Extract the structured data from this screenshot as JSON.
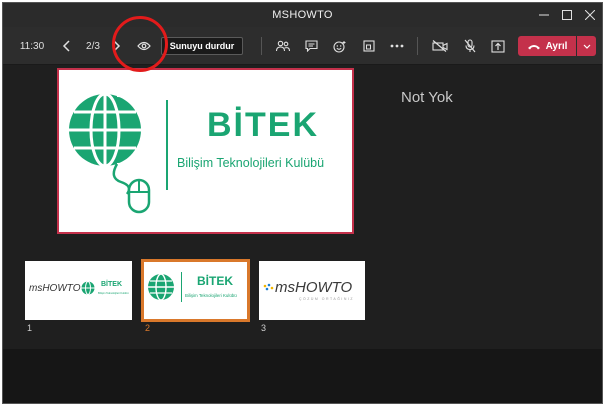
{
  "window": {
    "title": "MSHOWTO"
  },
  "toolbar": {
    "time": "11:30",
    "page_indicator": "2/3",
    "stop_presenting_label": "Sunuyu durdur",
    "leave_label": "Ayrıl"
  },
  "main_slide": {
    "brand": "BİTEK",
    "subtitle": "Bilişim Teknolojileri Kulübü"
  },
  "notes": {
    "text": "Not Yok"
  },
  "thumbnails": [
    {
      "number": "1",
      "label": "msHOWTO",
      "brand": "BİTEK",
      "subtitle": "Bilişim Teknolojileri Kulübü"
    },
    {
      "number": "2",
      "brand": "BİTEK",
      "subtitle": "Bilişim Teknolojileri Kulübü"
    },
    {
      "number": "3",
      "label": "msHOWTO",
      "tagline": "ÇÖZÜM ORTAĞINIZ"
    }
  ],
  "colors": {
    "accent_green": "#1aa572",
    "leave_red": "#c4314b",
    "selected_border": "#d9782b",
    "annotation_red": "#e21b1b"
  }
}
